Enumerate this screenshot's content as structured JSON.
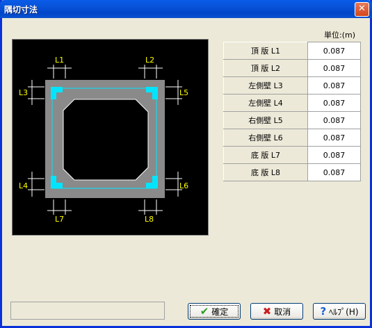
{
  "window": {
    "title": "隅切寸法",
    "close_label": "✕"
  },
  "unit_label": "単位:(m)",
  "diagram": {
    "labels": {
      "l1": "L1",
      "l2": "L2",
      "l3": "L3",
      "l4": "L4",
      "l5": "L5",
      "l6": "L6",
      "l7": "L7",
      "l8": "L8"
    }
  },
  "table": {
    "rows": [
      {
        "label": "頂 版 L1",
        "value": "0.087"
      },
      {
        "label": "頂 版 L2",
        "value": "0.087"
      },
      {
        "label": "左側壁 L3",
        "value": "0.087"
      },
      {
        "label": "左側壁 L4",
        "value": "0.087"
      },
      {
        "label": "右側壁 L5",
        "value": "0.087"
      },
      {
        "label": "右側壁 L6",
        "value": "0.087"
      },
      {
        "label": "底 版 L7",
        "value": "0.087"
      },
      {
        "label": "底 版 L8",
        "value": "0.087"
      }
    ]
  },
  "status_text": "",
  "buttons": {
    "ok": "確定",
    "cancel": "取消",
    "help": "ﾍﾙﾌﾟ(H)"
  },
  "icons": {
    "ok": "checkmark-icon",
    "cancel": "x-icon",
    "help": "question-icon"
  }
}
